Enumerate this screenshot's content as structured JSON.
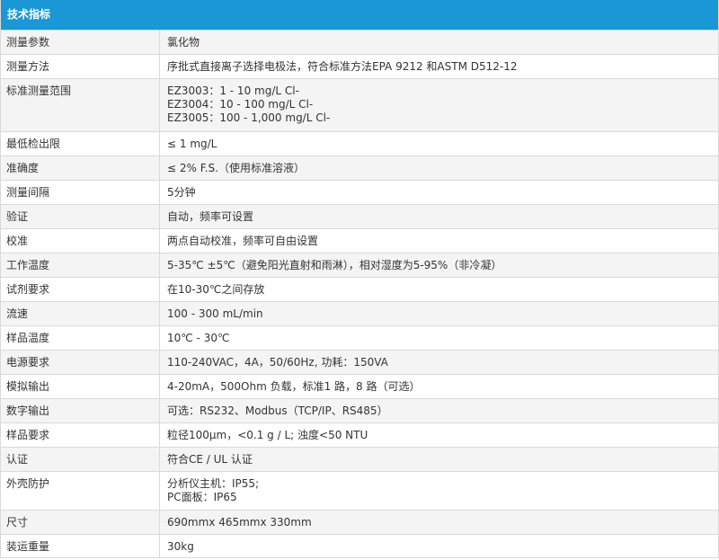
{
  "header": {
    "title": "技术指标"
  },
  "rows": [
    {
      "label": "测量参数",
      "values": [
        "氯化物"
      ]
    },
    {
      "label": "测量方法",
      "values": [
        "序批式直接离子选择电极法，符合标准方法EPA 9212 和ASTM D512-12"
      ]
    },
    {
      "label": "标准测量范围",
      "values": [
        "EZ3003：1 - 10 mg/L Cl-",
        "EZ3004：10 - 100 mg/L Cl-",
        "EZ3005：100 - 1,000 mg/L Cl-"
      ]
    },
    {
      "label": "最低检出限",
      "values": [
        "≤ 1 mg/L"
      ]
    },
    {
      "label": "准确度",
      "values": [
        "≤ 2% F.S.（使用标准溶液）"
      ]
    },
    {
      "label": "测量间隔",
      "values": [
        "5分钟"
      ]
    },
    {
      "label": "验证",
      "values": [
        "自动，频率可设置"
      ]
    },
    {
      "label": "校准",
      "values": [
        "两点自动校准，频率可自由设置"
      ]
    },
    {
      "label": "工作温度",
      "values": [
        "5-35℃ ±5℃（避免阳光直射和雨淋），相对湿度为5-95%（非冷凝）"
      ]
    },
    {
      "label": "试剂要求",
      "values": [
        "在10-30℃之间存放"
      ]
    },
    {
      "label": "流速",
      "values": [
        "100 - 300 mL/min"
      ]
    },
    {
      "label": "样品温度",
      "values": [
        "10℃ - 30℃"
      ]
    },
    {
      "label": "电源要求",
      "values": [
        "110-240VAC，4A，50/60Hz, 功耗：150VA"
      ]
    },
    {
      "label": "模拟输出",
      "values": [
        "4-20mA，500Ohm 负载，标准1 路，8 路（可选）"
      ]
    },
    {
      "label": "数字输出",
      "values": [
        "可选：RS232、Modbus（TCP/IP、RS485）"
      ]
    },
    {
      "label": "样品要求",
      "values": [
        "粒径100μm，<0.1 g / L; 浊度<50 NTU"
      ]
    },
    {
      "label": "认证",
      "values": [
        "符合CE / UL 认证"
      ]
    },
    {
      "label": "外壳防护",
      "values": [
        "分析仪主机：IP55;",
        "PC面板：IP65"
      ]
    },
    {
      "label": "尺寸",
      "values": [
        "690mmx 465mmx 330mm"
      ]
    },
    {
      "label": "装运重量",
      "values": [
        "30kg"
      ]
    }
  ]
}
